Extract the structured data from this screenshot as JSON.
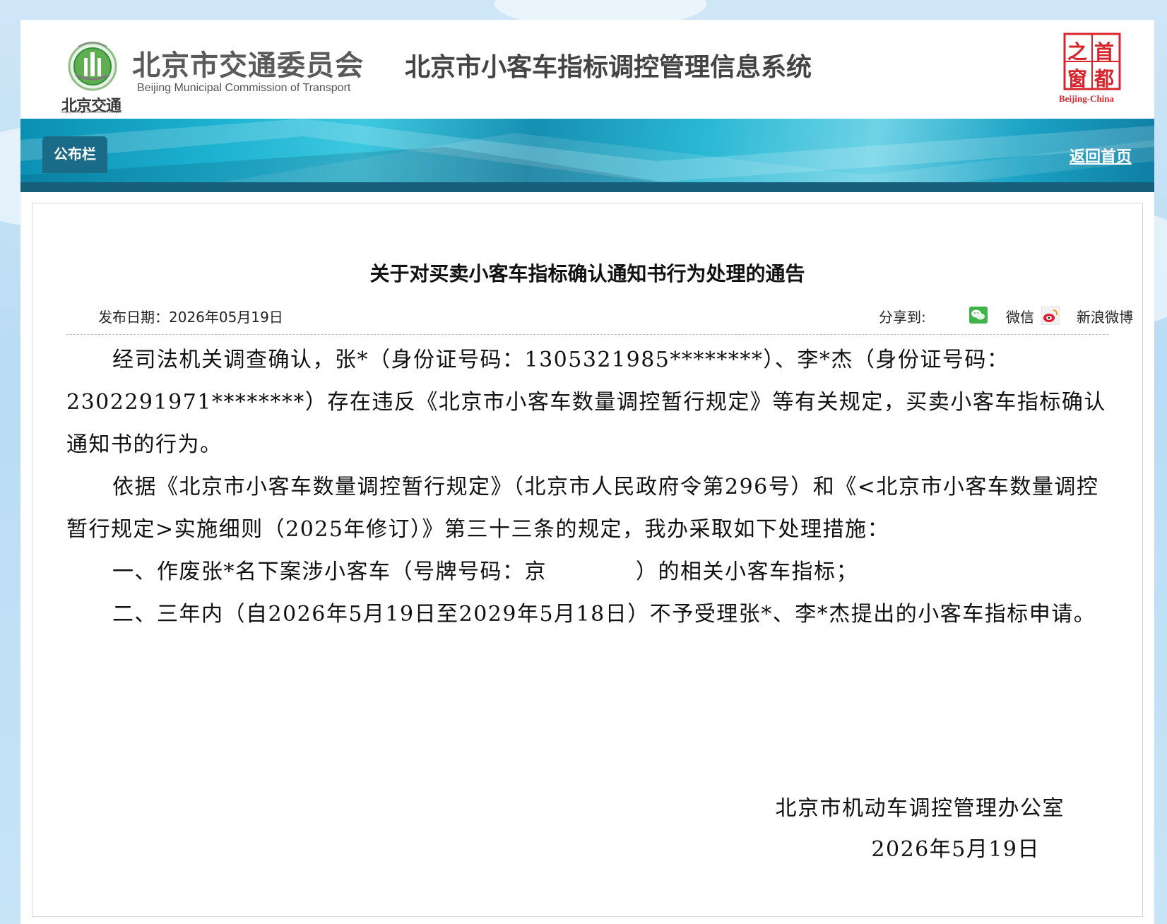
{
  "header": {
    "logo_emblem_text": "北京交通",
    "logo_emblem_subtext": "Beijing Municipal Commission of Transport",
    "commission_name_cn": "北京市交通委员会",
    "commission_name_en": "Beijing Municipal Commission of Transport",
    "system_title": "北京市小客车指标调控管理信息系统",
    "capital_logo_chars": [
      "首",
      "都",
      "之",
      "窗"
    ],
    "capital_logo_en": "Beijing-China"
  },
  "nav": {
    "tab_label": "公布栏",
    "home_link": "返回首页"
  },
  "notice": {
    "title": "关于对买卖小客车指标确认通知书行为处理的通告",
    "publish_date": "发布日期：2026年05月19日",
    "share_label": "分享到:",
    "share_wechat": "微信",
    "share_weibo": "新浪微博",
    "paragraphs": [
      "经司法机关调查确认，张*（身份证号码：1305321985********）、李*杰（身份证号码：2302291971********）存在违反《北京市小客车数量调控暂行规定》等有关规定，买卖小客车指标确认通知书的行为。",
      "依据《北京市小客车数量调控暂行规定》（北京市人民政府令第296号）和《<北京市小客车数量调控暂行规定>实施细则（2025年修订）》第三十三条的规定，我办采取如下处理措施：",
      "一、作废张*名下案涉小客车（号牌号码：京　　　　）的相关小客车指标；",
      "二、三年内（自2026年5月19日至2029年5月18日）不予受理张*、李*杰提出的小客车指标申请。"
    ],
    "signature_org": "北京市机动车调控管理办公室",
    "signature_date": "2026年5月19日"
  },
  "colors": {
    "banner_dark": "#155f7a",
    "banner_light": "#3ec8e0",
    "tab_bg": "#1a6b88",
    "capital_logo_red": "#d8232a",
    "emblem_green": "#2f8f3a"
  }
}
